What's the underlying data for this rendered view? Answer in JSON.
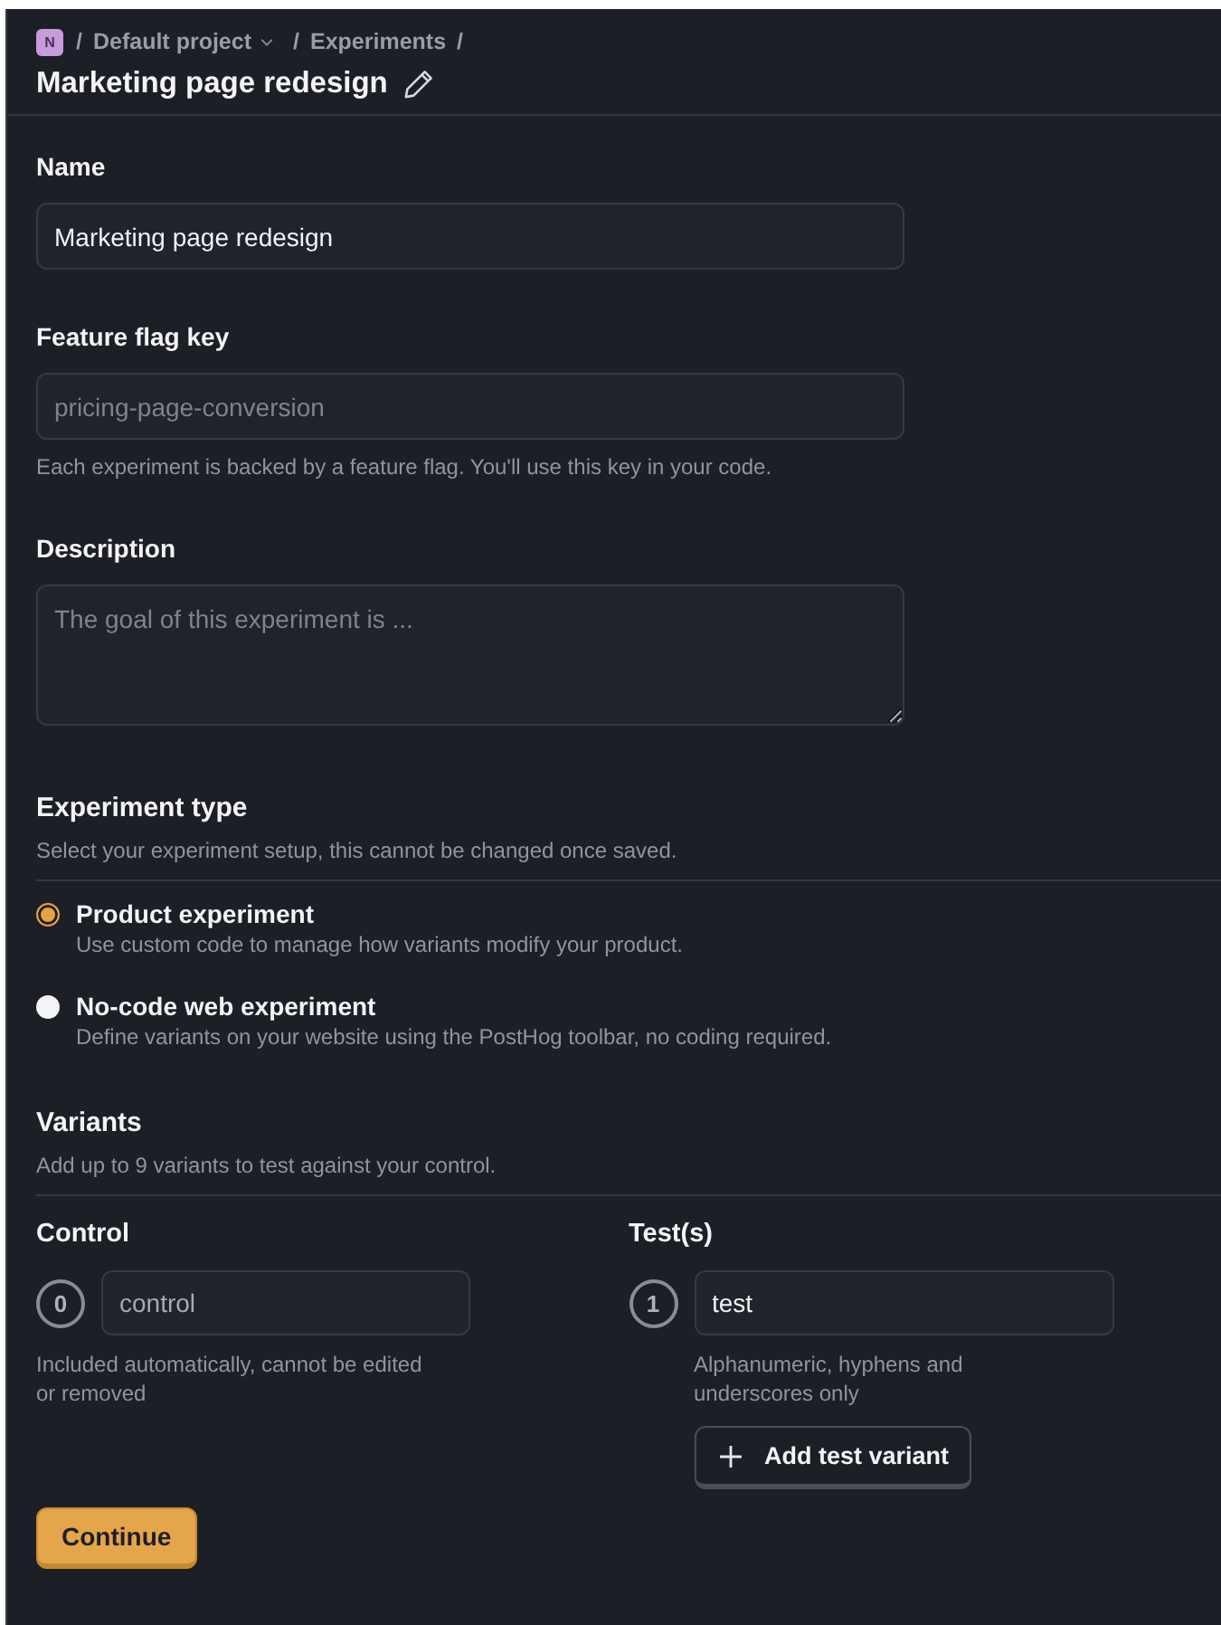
{
  "breadcrumb": {
    "avatar": "N",
    "separator": "/",
    "items": [
      {
        "label": "Default project",
        "dropdown": true
      },
      {
        "label": "Experiments",
        "dropdown": false
      }
    ]
  },
  "title": "Marketing page redesign",
  "fields": [
    {
      "kind": "input",
      "label": "Name",
      "value": "Marketing page redesign"
    },
    {
      "kind": "input",
      "label": "Feature flag key",
      "placeholder": "pricing-page-conversion",
      "help": "Each experiment is backed by a feature flag. You'll use this key in your code."
    },
    {
      "kind": "textarea",
      "label": "Description",
      "placeholder": "The goal of this experiment is ..."
    }
  ],
  "experiment_type": {
    "title": "Experiment type",
    "subtitle": "Select your experiment setup, this cannot be changed once saved.",
    "options": [
      {
        "label": "Product experiment",
        "description": "Use custom code to manage how variants modify your product.",
        "selected": true
      },
      {
        "label": "No-code web experiment",
        "description": "Define variants on your website using the PostHog toolbar, no coding required.",
        "selected": false
      }
    ]
  },
  "variants": {
    "title": "Variants",
    "subtitle": "Add up to 9 variants to test against your control.",
    "columns": [
      {
        "heading": "Control",
        "items": [
          {
            "index": "0",
            "value": "control",
            "disabled": true
          }
        ],
        "help": "Included automatically, cannot be edited or removed"
      },
      {
        "heading": "Test(s)",
        "items": [
          {
            "index": "1",
            "value": "test",
            "disabled": false
          }
        ],
        "help": "Alphanumeric, hyphens and underscores only",
        "add_button": "Add test variant"
      }
    ]
  },
  "continue_button": "Continue"
}
